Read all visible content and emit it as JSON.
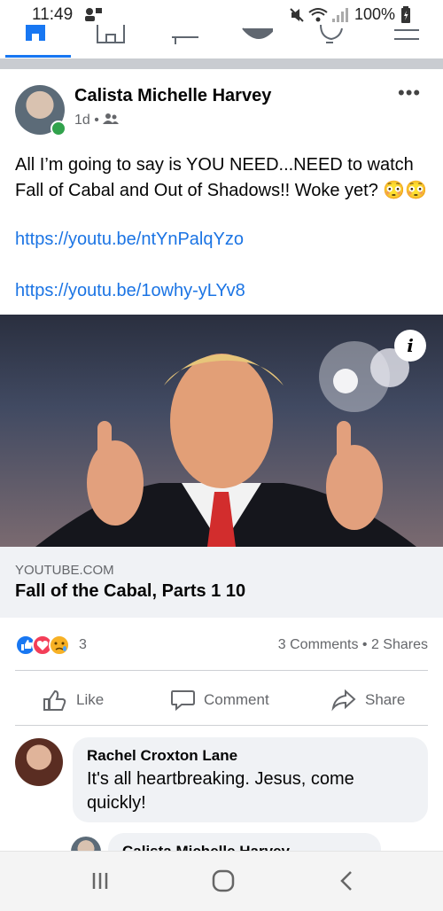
{
  "status_bar": {
    "time": "11:49",
    "battery": "100%"
  },
  "post": {
    "author": "Calista Michelle Harvey",
    "time": "1d",
    "text": "All I’m going to say is YOU NEED...NEED to watch Fall of Cabal and Out of Shadows!! Woke yet? 😳😳",
    "link1": "https://youtu.be/ntYnPalqYzo",
    "link2": "https://youtu.be/1owhy-yLYv8",
    "link_preview": {
      "domain": "YOUTUBE.COM",
      "title": "Fall of the Cabal, Parts 1 10"
    },
    "reaction_count": "3",
    "stats": "3 Comments • 2 Shares",
    "actions": {
      "like": "Like",
      "comment": "Comment",
      "share": "Share"
    }
  },
  "comments": [
    {
      "name": "Rachel Croxton Lane",
      "text": "It's all heartbreaking. Jesus, come quickly!"
    },
    {
      "name": "Calista Michelle Harvey"
    }
  ],
  "icons": {
    "status": [
      "profile-notif-icon",
      "mute-icon",
      "wifi-icon",
      "signal-icon",
      "battery-icon"
    ],
    "nav": [
      "home-icon",
      "marketplace-icon",
      "watch-icon",
      "profile-icon",
      "notifications-icon",
      "menu-icon"
    ],
    "reactions": [
      "like-reaction-icon",
      "love-reaction-icon",
      "care-reaction-icon"
    ]
  }
}
